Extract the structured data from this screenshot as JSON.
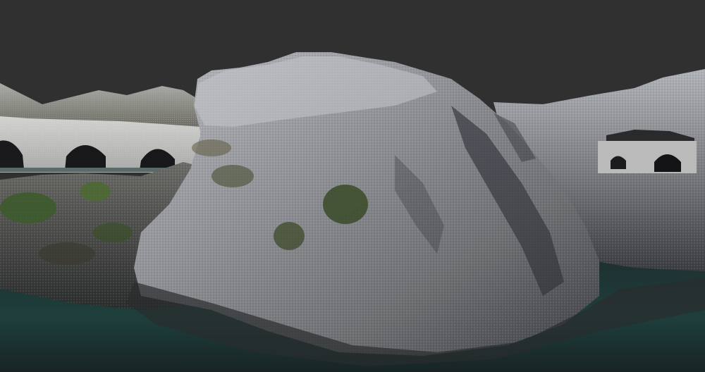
{
  "viewer": {
    "background_color": "#303030",
    "content": "coastal-cliff-point-cloud"
  },
  "scene": {
    "palette": {
      "rock_light": "#b9bcc2",
      "rock_mid": "#8c8e92",
      "rock_dark": "#4a4a4c",
      "rock_shadow": "#2c2e34",
      "moss": "#5a5a3a",
      "vegetation": "#3f5a2c",
      "concrete": "#c8c8c6",
      "arch_void": "#1a1a1c",
      "water_dark": "#1c2a2a",
      "water_teal": "#1f4a48"
    },
    "elements": {
      "bridge_left_arches": 3,
      "tunnel_right_openings": 2
    }
  }
}
